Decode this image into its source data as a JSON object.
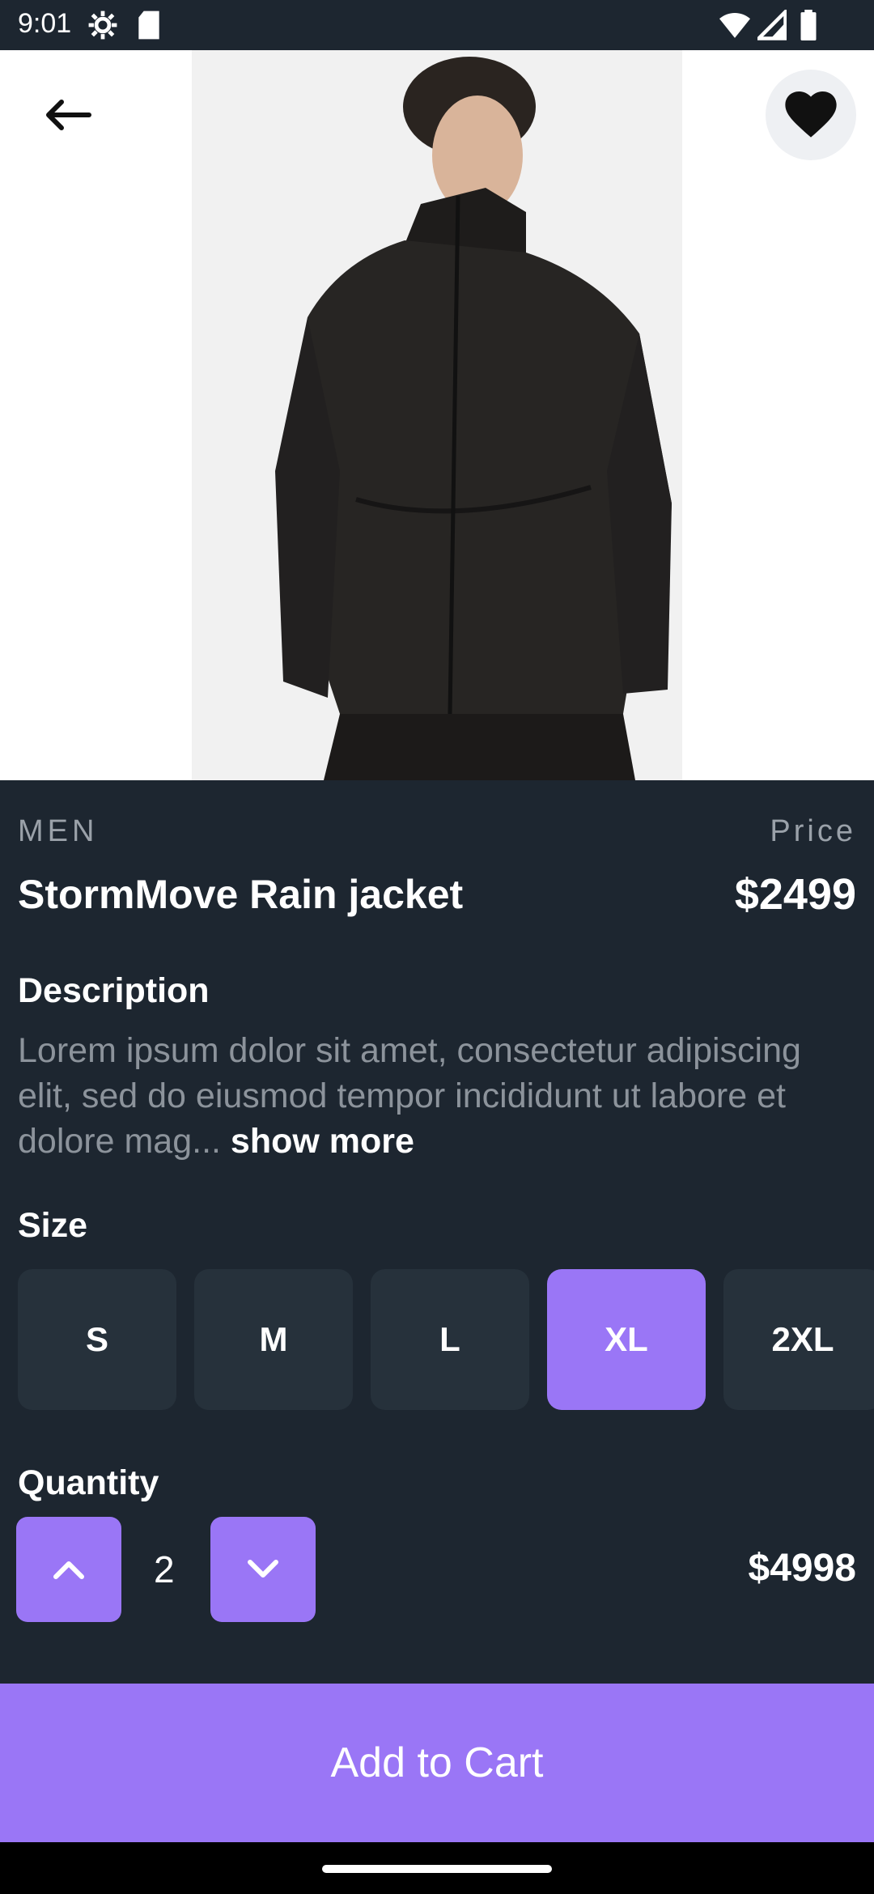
{
  "status_bar": {
    "time": "9:01",
    "icons": [
      "settings-gear-icon",
      "sd-card-icon",
      "wifi-icon",
      "cell-signal-icon",
      "battery-icon"
    ]
  },
  "header": {
    "back_icon": "arrow-left-icon",
    "favorite_icon": "heart-filled-icon"
  },
  "product": {
    "category": "MEN",
    "name": "StormMove Rain jacket",
    "price_label": "Price",
    "price": "$2499"
  },
  "description": {
    "title": "Description",
    "text": "Lorem ipsum dolor sit amet, consectetur adipiscing elit, sed do eiusmod tempor incididunt ut labore et dolore mag...",
    "show_more": "show more"
  },
  "size": {
    "title": "Size",
    "options": [
      "S",
      "M",
      "L",
      "XL",
      "2XL"
    ],
    "selected": "XL"
  },
  "quantity": {
    "title": "Quantity",
    "value": "2",
    "increase_icon": "chevron-up-icon",
    "decrease_icon": "chevron-down-icon",
    "total": "$4998"
  },
  "cart": {
    "label": "Add to Cart"
  },
  "colors": {
    "accent": "#9a76f6",
    "background": "#1d2630",
    "chip": "#26313b",
    "muted_text": "#8c939b"
  }
}
